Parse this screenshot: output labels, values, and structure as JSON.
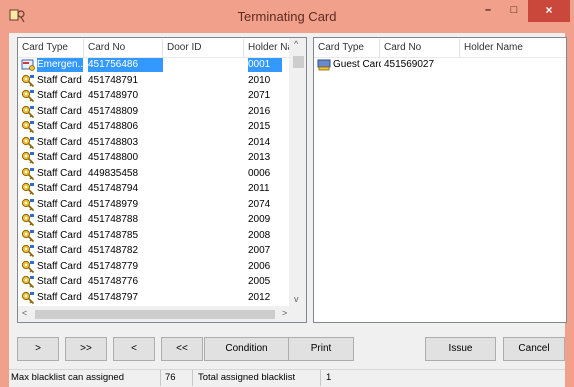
{
  "window": {
    "title": "Terminating Card",
    "minimize_glyph": "–",
    "maximize_glyph": "□",
    "close_glyph": "×",
    "accent_color": "#f0a08b",
    "close_color": "#c9473b"
  },
  "left_list": {
    "columns": [
      "Card Type",
      "Card No",
      "Door ID",
      "Holder Nam"
    ],
    "rows": [
      {
        "card_type": "Emergen...",
        "card_no": "451756486",
        "door_id": "",
        "holder": "0001",
        "icon": "emergency-card-icon",
        "selected": true
      },
      {
        "card_type": "Staff Card",
        "card_no": "451748791",
        "door_id": "",
        "holder": "2010",
        "icon": "staff-key-icon"
      },
      {
        "card_type": "Staff Card",
        "card_no": "451748970",
        "door_id": "",
        "holder": "2071",
        "icon": "staff-key-icon"
      },
      {
        "card_type": "Staff Card",
        "card_no": "451748809",
        "door_id": "",
        "holder": "2016",
        "icon": "staff-key-icon"
      },
      {
        "card_type": "Staff Card",
        "card_no": "451748806",
        "door_id": "",
        "holder": "2015",
        "icon": "staff-key-icon"
      },
      {
        "card_type": "Staff Card",
        "card_no": "451748803",
        "door_id": "",
        "holder": "2014",
        "icon": "staff-key-icon"
      },
      {
        "card_type": "Staff Card",
        "card_no": "451748800",
        "door_id": "",
        "holder": "2013",
        "icon": "staff-key-icon"
      },
      {
        "card_type": "Staff Card",
        "card_no": "449835458",
        "door_id": "",
        "holder": "0006",
        "icon": "staff-key-icon"
      },
      {
        "card_type": "Staff Card",
        "card_no": "451748794",
        "door_id": "",
        "holder": "2011",
        "icon": "staff-key-icon"
      },
      {
        "card_type": "Staff Card",
        "card_no": "451748979",
        "door_id": "",
        "holder": "2074",
        "icon": "staff-key-icon"
      },
      {
        "card_type": "Staff Card",
        "card_no": "451748788",
        "door_id": "",
        "holder": "2009",
        "icon": "staff-key-icon"
      },
      {
        "card_type": "Staff Card",
        "card_no": "451748785",
        "door_id": "",
        "holder": "2008",
        "icon": "staff-key-icon"
      },
      {
        "card_type": "Staff Card",
        "card_no": "451748782",
        "door_id": "",
        "holder": "2007",
        "icon": "staff-key-icon"
      },
      {
        "card_type": "Staff Card",
        "card_no": "451748779",
        "door_id": "",
        "holder": "2006",
        "icon": "staff-key-icon"
      },
      {
        "card_type": "Staff Card",
        "card_no": "451748776",
        "door_id": "",
        "holder": "2005",
        "icon": "staff-key-icon"
      },
      {
        "card_type": "Staff Card",
        "card_no": "451748797",
        "door_id": "",
        "holder": "2012",
        "icon": "staff-key-icon"
      }
    ]
  },
  "right_list": {
    "columns": [
      "Card Type",
      "Card No",
      "Holder Name"
    ],
    "rows": [
      {
        "card_type": "Guest Card",
        "card_no": "451569027",
        "holder": "",
        "icon": "guest-card-icon"
      }
    ]
  },
  "buttons": {
    "move_right": ">",
    "move_all_right": ">>",
    "move_left": "<",
    "move_all_left": "<<",
    "condition": "Condition",
    "print": "Print",
    "issue": "Issue",
    "cancel": "Cancel"
  },
  "status": {
    "max_label": "Max blacklist can assigned",
    "max_value": "76",
    "total_label": "Total assigned blacklist",
    "total_value": "1"
  }
}
